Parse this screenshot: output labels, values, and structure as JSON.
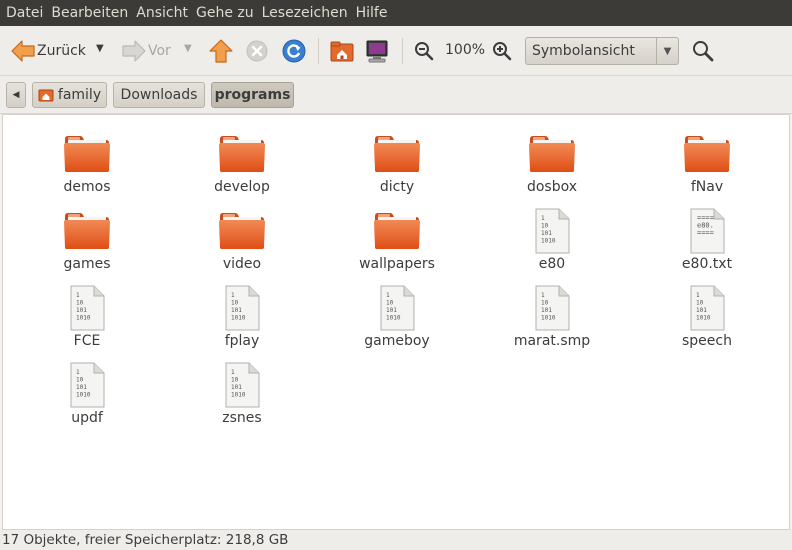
{
  "menubar": {
    "items": [
      "Datei",
      "Bearbeiten",
      "Ansicht",
      "Gehe zu",
      "Lesezeichen",
      "Hilfe"
    ]
  },
  "toolbar": {
    "back_label": "Zurück",
    "forward_label": "Vor",
    "zoom_level": "100%",
    "view_mode": "Symbolansicht"
  },
  "pathbar": {
    "crumbs": [
      "family",
      "Downloads",
      "programs"
    ]
  },
  "files": {
    "items": [
      {
        "name": "demos",
        "type": "folder"
      },
      {
        "name": "develop",
        "type": "folder"
      },
      {
        "name": "dicty",
        "type": "folder"
      },
      {
        "name": "dosbox",
        "type": "folder"
      },
      {
        "name": "fNav",
        "type": "folder"
      },
      {
        "name": "games",
        "type": "folder"
      },
      {
        "name": "video",
        "type": "folder"
      },
      {
        "name": "wallpapers",
        "type": "folder"
      },
      {
        "name": "e80",
        "type": "binary"
      },
      {
        "name": "e80.txt",
        "type": "text"
      },
      {
        "name": "FCE",
        "type": "binary"
      },
      {
        "name": "fplay",
        "type": "binary"
      },
      {
        "name": "gameboy",
        "type": "binary"
      },
      {
        "name": "marat.smp",
        "type": "binary"
      },
      {
        "name": "speech",
        "type": "binary"
      },
      {
        "name": "updf",
        "type": "binary"
      },
      {
        "name": "zsnes",
        "type": "binary"
      }
    ]
  },
  "icon_text": {
    "binary_lines": [
      "1",
      "10",
      "101",
      "1010"
    ],
    "text_lines": [
      "====",
      "e80.",
      "===="
    ]
  },
  "statusbar": {
    "text": "17 Objekte, freier Speicherplatz: 218,8 GB"
  },
  "colors": {
    "menubar_bg": "#3c3b37",
    "folder_orange": "#e95a1c",
    "window_bg": "#f2f1ef"
  }
}
